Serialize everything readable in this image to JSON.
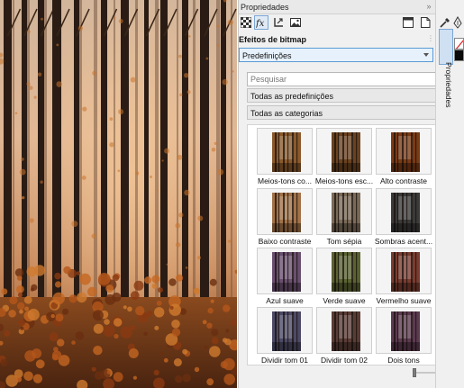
{
  "canvas": {
    "image_description": "autumn forest"
  },
  "panel": {
    "title": "Propriedades",
    "tabs": [
      {
        "icon": "checkerboard-fill-icon",
        "active": false
      },
      {
        "icon": "fx-effects-icon",
        "active": true
      },
      {
        "icon": "transform-icon",
        "active": false
      },
      {
        "icon": "bitmap-image-icon",
        "active": false
      }
    ],
    "section_label": "Efeitos de bitmap",
    "category_dropdown": {
      "value": "Predefinições"
    },
    "search": {
      "placeholder": "Pesquisar"
    },
    "filter_presets": {
      "value": "Todas as predefinições"
    },
    "filter_categories": {
      "value": "Todas as categorias"
    },
    "presets": [
      {
        "label": "Meios-tons co...",
        "tone": "#8a5a2c"
      },
      {
        "label": "Meios-tons esc...",
        "tone": "#6a4220"
      },
      {
        "label": "Alto contraste",
        "tone": "#7a3a14"
      },
      {
        "label": "Baixo contraste",
        "tone": "#a27248"
      },
      {
        "label": "Tom sépia",
        "tone": "#7a6a58"
      },
      {
        "label": "Sombras acent...",
        "tone": "#3a3a3a"
      },
      {
        "label": "Azul suave",
        "tone": "#6a5070"
      },
      {
        "label": "Verde suave",
        "tone": "#5a6232"
      },
      {
        "label": "Vermelho suave",
        "tone": "#7a3c30"
      },
      {
        "label": "Dividir tom 01",
        "tone": "#4c4a66"
      },
      {
        "label": "Dividir tom 02",
        "tone": "#5a3c36"
      },
      {
        "label": "Dois tons",
        "tone": "#5c3a50"
      }
    ]
  },
  "side_strip": {
    "tab_label": "Propriedades"
  },
  "colors": {
    "accent": "#5c9bd6",
    "selected_tab": "#dfeaf6"
  }
}
